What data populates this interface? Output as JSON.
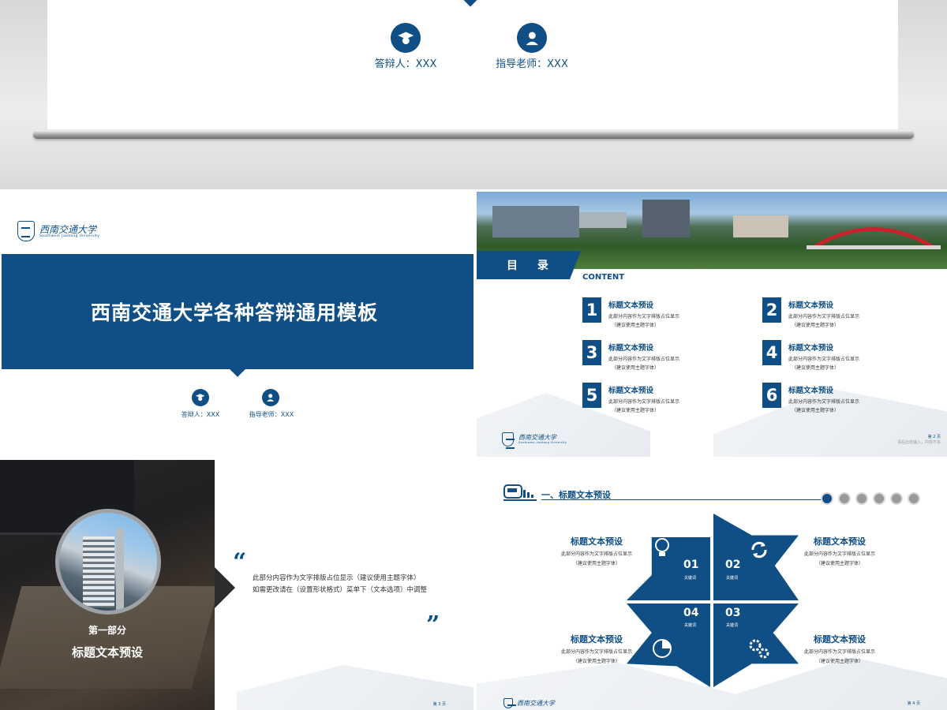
{
  "top": {
    "presenter": "答辩人：XXX",
    "advisor": "指导老师：XXX"
  },
  "cover": {
    "logo_text": "西南交通大学",
    "logo_sub": "Southwest Jiaotong University",
    "title": "西南交通大学各种答辩通用模板",
    "presenter": "答辩人：XXX",
    "advisor": "指导老师：XXX"
  },
  "contents": {
    "tab": "目 录",
    "subtitle": "CONTENT",
    "items": [
      {
        "num": "1",
        "title": "标题文本预设",
        "line1": "此部分内容作为文字排版占位显示",
        "line2": "（建议使用主题字体）"
      },
      {
        "num": "2",
        "title": "标题文本预设",
        "line1": "此部分内容作为文字排版占位显示",
        "line2": "（建议使用主题字体）"
      },
      {
        "num": "3",
        "title": "标题文本预设",
        "line1": "此部分内容作为文字排版占位显示",
        "line2": "（建议使用主题字体）"
      },
      {
        "num": "4",
        "title": "标题文本预设",
        "line1": "此部分内容作为文字排版占位显示",
        "line2": "（建议使用主题字体）"
      },
      {
        "num": "5",
        "title": "标题文本预设",
        "line1": "此部分内容作为文字排版占位显示",
        "line2": "（建议使用主题字体）"
      },
      {
        "num": "6",
        "title": "标题文本预设",
        "line1": "此部分内容作为文字排版占位显示",
        "line2": "（建议使用主题字体）"
      }
    ],
    "logo_text": "西南交通大学",
    "logo_sub": "Southwest Jiaotong University",
    "page": "第 2 页",
    "page_note": "请在此处输入，内容不多"
  },
  "section": {
    "part": "第一部分",
    "title": "标题文本预设",
    "open_quote": "“",
    "close_quote": "”",
    "line1": "此部分内容作为文字排版占位显示（建议使用主题字体）",
    "line2": "如需更改请在（设置形状格式）菜单下（文本选项）中调整",
    "page": "第 3 页"
  },
  "slide4": {
    "header": "一、标题文本预设",
    "blocks": [
      {
        "num": "01",
        "kw": "关键词"
      },
      {
        "num": "02",
        "kw": "关键词"
      },
      {
        "num": "03",
        "kw": "关键词"
      },
      {
        "num": "04",
        "kw": "关键词"
      }
    ],
    "sides": [
      {
        "title": "标题文本预设",
        "line1": "此部分内容作为文字排版占位显示",
        "line2": "（建议使用主题字体）"
      },
      {
        "title": "标题文本预设",
        "line1": "此部分内容作为文字排版占位显示",
        "line2": "（建议使用主题字体）"
      },
      {
        "title": "标题文本预设",
        "line1": "此部分内容作为文字排版占位显示",
        "line2": "（建议使用主题字体）"
      },
      {
        "title": "标题文本预设",
        "line1": "此部分内容作为文字排版占位显示",
        "line2": "（建议使用主题字体）"
      }
    ],
    "logo_text": "西南交通大学",
    "page": "第 4 页"
  },
  "colors": {
    "primary": "#0f4f85",
    "bar": "#9b9b9b"
  }
}
